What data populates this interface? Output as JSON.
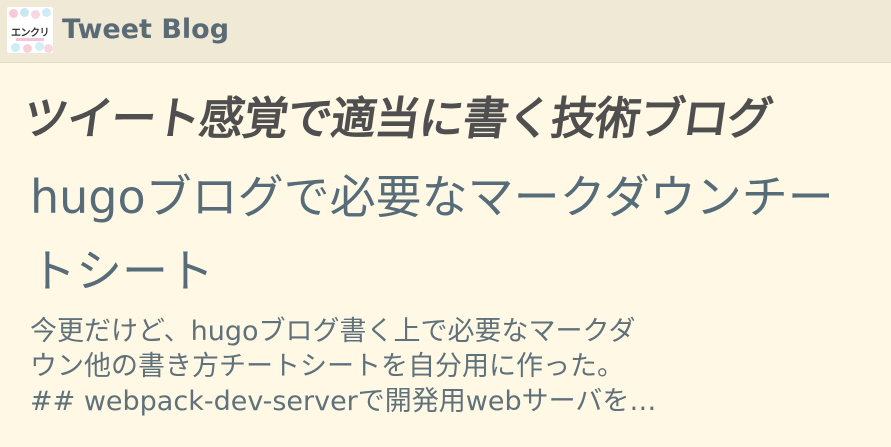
{
  "header": {
    "logo_text": "エンクリ",
    "site_title": "Tweet Blog"
  },
  "tagline": "ツイート感覚で適当に書く技術ブログ",
  "post": {
    "title": "hugoブログで必要なマークダウンチートシート",
    "excerpt_lines": [
      "今更だけど、hugoブログ書く上で必要なマークダ",
      "ウン他の書き方チートシートを自分用に作った。",
      "## webpack-dev-serverで開発用webサーバを…"
    ]
  },
  "colors": {
    "background": "#fff8e4",
    "header_bg": "#f0e9d5",
    "title_color": "#566c78"
  }
}
